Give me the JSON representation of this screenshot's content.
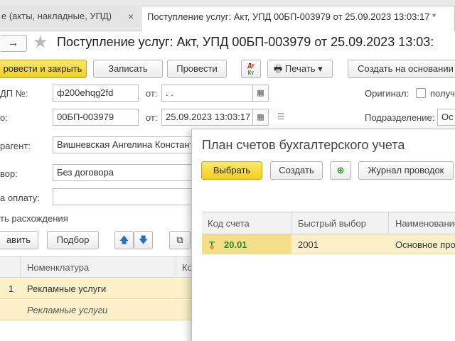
{
  "tabs": [
    {
      "label": "е (акты, накладные, УПД)",
      "close": "×"
    },
    {
      "label": "Поступление услуг: Акт, УПД 00БП-003979 от 25.09.2023 13:03:17 *",
      "close": ""
    }
  ],
  "header": {
    "nav_arrow": "→",
    "star": "★",
    "title": "Поступление услуг: Акт, УПД 00БП-003979 от 25.09.2023 13:03:"
  },
  "toolbar": {
    "post_close": "ровести и закрыть",
    "write": "Записать",
    "post": "Провести",
    "dtkt_top": "Дт",
    "dtkt_bottom": "Кт",
    "print": "Печать",
    "print_arrow": "▾",
    "create_based": "Создать на основании"
  },
  "form": {
    "invoice_label": "ДП №:",
    "invoice_value": "ф200ehqg2fd",
    "from1_label": "от:",
    "from1_value": " .  .",
    "original_label": "Оригинал:",
    "received_label": "получ",
    "number_label": "о:",
    "number_value": "00БП-003979",
    "from2_label": "от:",
    "from2_value": "25.09.2023 13:03:17",
    "division_label": "Подразделение:",
    "division_value": "Ос",
    "counterparty_label": "рагент:",
    "counterparty_value": "Вишневская Ангелина Констант",
    "contract_label": "вор:",
    "contract_value": "Без договора",
    "payment_label": "а оплату:",
    "payment_value": "",
    "discrepancy_link": "ть расхождения"
  },
  "items_toolbar": {
    "add": "авить",
    "pick": "Подбор"
  },
  "items_table": {
    "headers": [
      "Номенклатура",
      "Ко"
    ],
    "rows": [
      {
        "num": "1",
        "name": "Рекламные услуги"
      },
      {
        "num": "",
        "name": "Рекламные услуги"
      }
    ]
  },
  "popup": {
    "title": "План счетов бухгалтерского учета",
    "select": "Выбрать",
    "create": "Создать",
    "journal": "Журнал проводок",
    "headers": [
      "Код счета",
      "Быстрый выбор",
      "Наименование"
    ],
    "rows": [
      {
        "icon": "Т",
        "code": "20.01",
        "quick": "2001",
        "name": "Основное про"
      }
    ]
  },
  "colors": {
    "accent_yellow": "#f1cf1c",
    "selected_row": "#fbf0c8",
    "account_code": "#2a8a2a"
  }
}
